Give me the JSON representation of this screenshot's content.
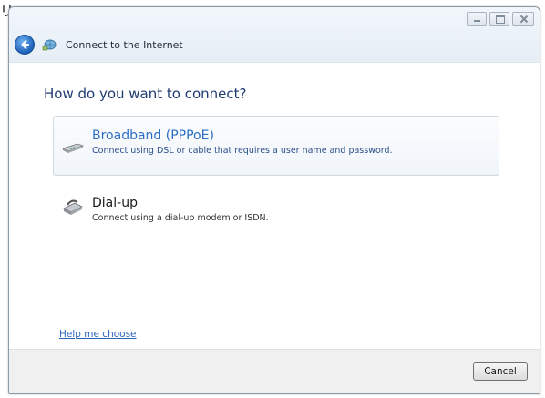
{
  "corner_text": "リッ",
  "window": {
    "title": "Connect to the Internet",
    "controls": {
      "minimize_icon": "minimize-icon",
      "maximize_icon": "maximize-icon",
      "close_icon": "close-icon"
    }
  },
  "main": {
    "heading": "How do you want to connect?",
    "options": [
      {
        "title": "Broadband (PPPoE)",
        "description": "Connect using DSL or cable that requires a user name and password.",
        "icon": "broadband-modem-icon",
        "highlighted": true
      },
      {
        "title": "Dial-up",
        "description": "Connect using a dial-up modem or ISDN.",
        "icon": "dialup-modem-icon",
        "highlighted": false
      }
    ],
    "help_link": "Help me choose"
  },
  "footer": {
    "cancel_label": "Cancel"
  },
  "colors": {
    "heading": "#1e3b70",
    "link": "#2a64b8",
    "selected_title": "#2c6fc2"
  }
}
